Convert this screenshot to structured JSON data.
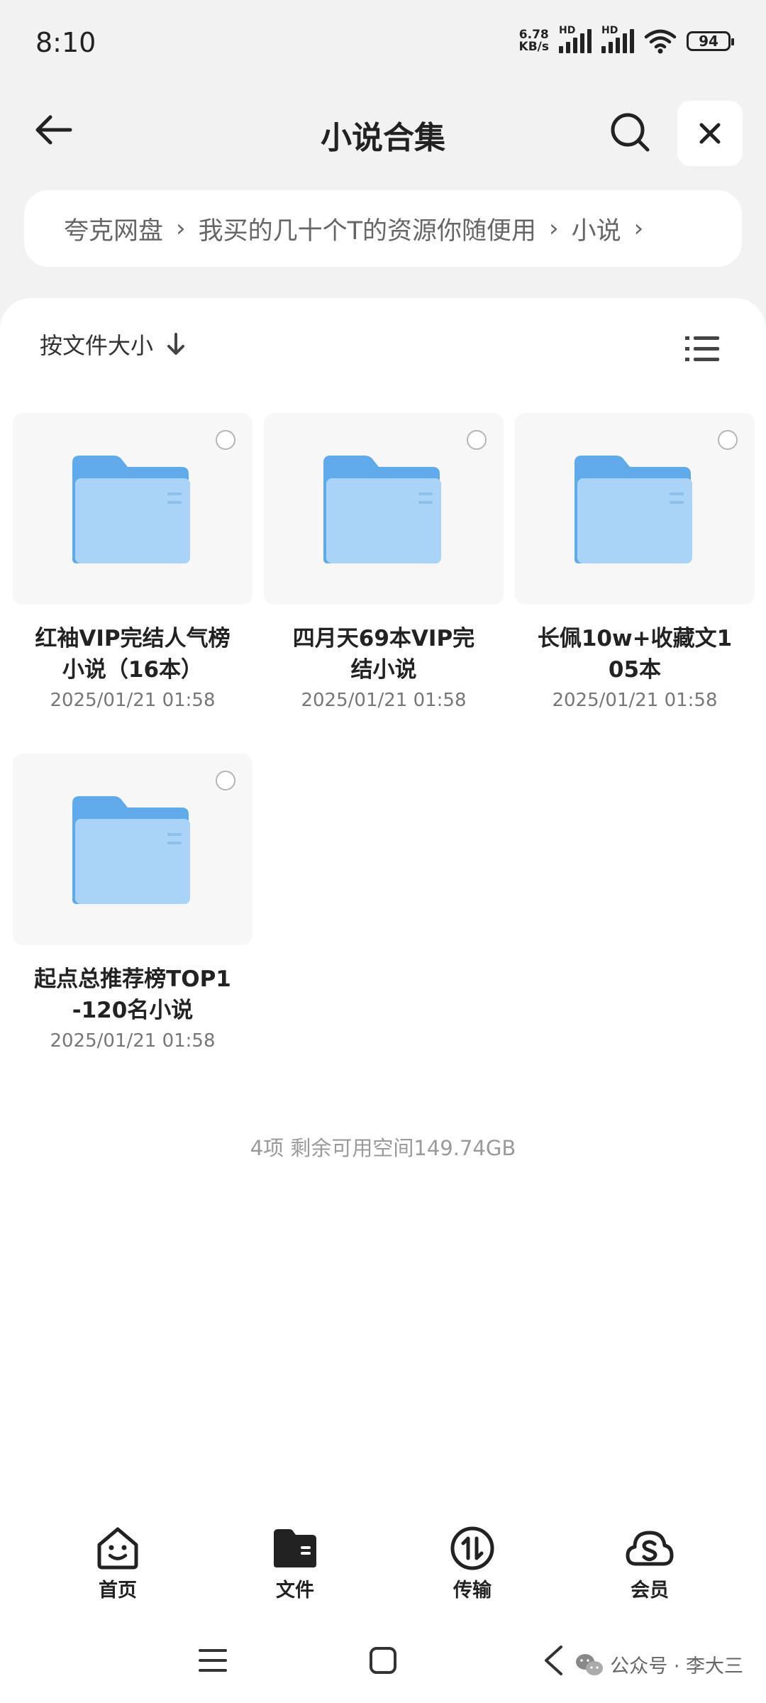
{
  "status_bar": {
    "time": "8:10",
    "net_speed_value": "6.78",
    "net_speed_unit": "KB/s",
    "signal1_label": "HD",
    "signal2_label": "HD",
    "battery": "94"
  },
  "header": {
    "title": "小说合集",
    "back_icon": "arrow-left-icon",
    "search_icon": "search-icon",
    "close_icon": "close-icon"
  },
  "breadcrumb": {
    "items": [
      "夸克网盘",
      "我买的几十个T的资源你随便用",
      "小说"
    ],
    "separator": "›"
  },
  "sort": {
    "label": "按文件大小",
    "icon": "arrow-down-icon"
  },
  "folders": [
    {
      "name_line1": "红袖VIP完结人气榜",
      "name_line2": "小说（16本）",
      "date": "2025/01/21 01:58"
    },
    {
      "name_line1": "四月天69本VIP完",
      "name_line2": "结小说",
      "date": "2025/01/21 01:58"
    },
    {
      "name_line1": "长佩10w+收藏文1",
      "name_line2": "05本",
      "date": "2025/01/21 01:58"
    },
    {
      "name_line1": "起点总推荐榜TOP1",
      "name_line2": "-120名小说",
      "date": "2025/01/21 01:58"
    }
  ],
  "summary": "4项 剩余可用空间149.74GB",
  "bottom_nav": [
    {
      "label": "首页",
      "icon": "home-smile-icon"
    },
    {
      "label": "文件",
      "icon": "folder-icon"
    },
    {
      "label": "传输",
      "icon": "transfer-icon"
    },
    {
      "label": "会员",
      "icon": "vip-cloud-icon"
    }
  ],
  "watermark": "公众号 · 李大三",
  "colors": {
    "background": "#f2f2f2",
    "folder_blue": "#6db3ee",
    "folder_front": "#a9d3f7"
  }
}
